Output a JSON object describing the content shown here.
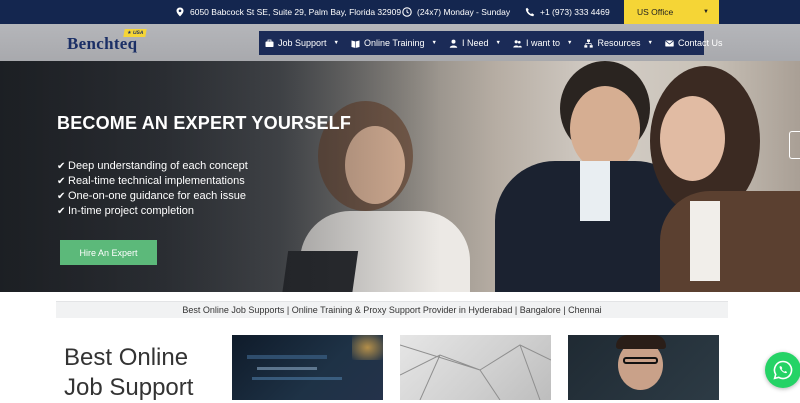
{
  "topbar": {
    "address": "6050 Babcock St SE, Suite 29, Palm Bay, Florida 32909",
    "hours": "(24x7) Monday - Sunday",
    "phone": "+1 (973) 333 4469",
    "office_select": "US Office",
    "background": "#14264f",
    "office_color": "#f5d536"
  },
  "logo": {
    "text": "Benchteq",
    "badge": "★ USA"
  },
  "menu": {
    "items": [
      {
        "label": "Job Support",
        "icon": "briefcase-icon"
      },
      {
        "label": "Online Training",
        "icon": "book-icon"
      },
      {
        "label": "I Need",
        "icon": "user-icon"
      },
      {
        "label": "I want to",
        "icon": "users-icon"
      },
      {
        "label": "Resources",
        "icon": "sitemap-icon"
      },
      {
        "label": "Contact Us",
        "icon": "envelope-icon"
      }
    ],
    "background": "#1b2b57"
  },
  "hero": {
    "title": "BECOME AN EXPERT YOURSELF",
    "bullets": [
      "Deep understanding of each concept",
      "Real-time technical implementations",
      "One-on-one guidance for each issue",
      "In-time project completion"
    ],
    "cta": "Hire An Expert",
    "cta_color": "#5cb97a"
  },
  "tagline": "Best Online Job Supports | Online Training & Proxy Support Provider in Hyderabad | Bangalore | Chennai",
  "section": {
    "heading_line1": "Best Online",
    "heading_line2": "Job Support"
  },
  "whatsapp": {
    "icon": "whatsapp-icon",
    "color": "#25d366"
  }
}
